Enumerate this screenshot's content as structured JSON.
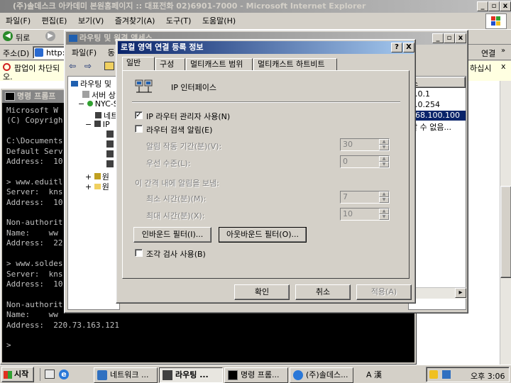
{
  "ie": {
    "title": "(주)솔데스크 아카데미 본원홈페이지 :: 대표전화 02)6901-7000 - Microsoft Internet Explorer",
    "menu": [
      "파일(F)",
      "편집(E)",
      "보기(V)",
      "즐겨찾기(A)",
      "도구(T)",
      "도움말(H)"
    ],
    "back_label": "뒤로",
    "address_label": "주소(D)",
    "address_value": "http:",
    "links_label": "연결",
    "popup_text": "팝업이 차단되",
    "popup_right": "하십시",
    "popup_line2": "오."
  },
  "rras": {
    "title": "라우팅 및 원격 액세스",
    "menu": [
      "파일(F)",
      "동"
    ],
    "tree": [
      "라우팅 및",
      "서버 상",
      "NYC-S",
      "네트",
      "IP"
    ],
    "tree_bottom": [
      "원",
      "원"
    ],
    "list_header": "소",
    "list_rows": [
      "0.0.1",
      "0.0.254",
      "168.100.100",
      "할 수 없음..."
    ]
  },
  "cmd": {
    "title": "명령 프롬프",
    "lines": [
      "Microsoft W",
      "(C) Copyrigh",
      "",
      "C:\\Documents",
      "Default Serv",
      "Address:  10",
      "",
      "> www.eduitl",
      "Server:  kns",
      "Address:  10",
      "",
      "Non-authorit",
      "Name:    ww",
      "Address:  22",
      "",
      "> www.soldes",
      "Server:  kns",
      "Address:  10",
      "",
      "Non-authorit",
      "Name:    ww",
      "Address:  220.73.163.121",
      "",
      ">"
    ]
  },
  "dialog": {
    "title": "로컬 영역 연결 등록 정보",
    "help_btn": "?",
    "close_btn": "X",
    "tabs": [
      "일반",
      "구성",
      "멀티캐스트 범위",
      "멀티캐스트 하트비트"
    ],
    "interface_label": "IP 인터페이스",
    "enable_router_manager": "IP 라우터 관리자 사용(N)",
    "enable_router_discovery": "라우터 검색 알림(E)",
    "advert_lifetime_label": "알림 작동 기간(분)(V):",
    "advert_lifetime_value": "30",
    "preference_label": "우선 수준(L):",
    "preference_value": "0",
    "interval_label": "이 간격 내에 알림을 보냄:",
    "min_time_label": "최소 시간(분)(M):",
    "min_time_value": "7",
    "max_time_label": "최대 시간(분)(X):",
    "max_time_value": "10",
    "inbound_filter": "인바운드 필터(I)...",
    "outbound_filter": "아웃바운드 필터(O)...",
    "fragment_check": "조각 검사 사용(B)",
    "ok": "확인",
    "cancel": "취소",
    "apply": "적용(A)"
  },
  "taskbar": {
    "start": "시작",
    "items": [
      "네트워크 ...",
      "라우팅 ...",
      "명령 프롬...",
      "(주)솔데스..."
    ],
    "ime": "A 漢",
    "clock": "오후 3:06"
  },
  "colors": {
    "title_active": "#0a246a",
    "title_active_end": "#a6caf0",
    "face": "#d4d0c8",
    "taskbar": "#d4d0c8",
    "desktop": "#3a6ea5",
    "highlight": "#0a246a"
  }
}
